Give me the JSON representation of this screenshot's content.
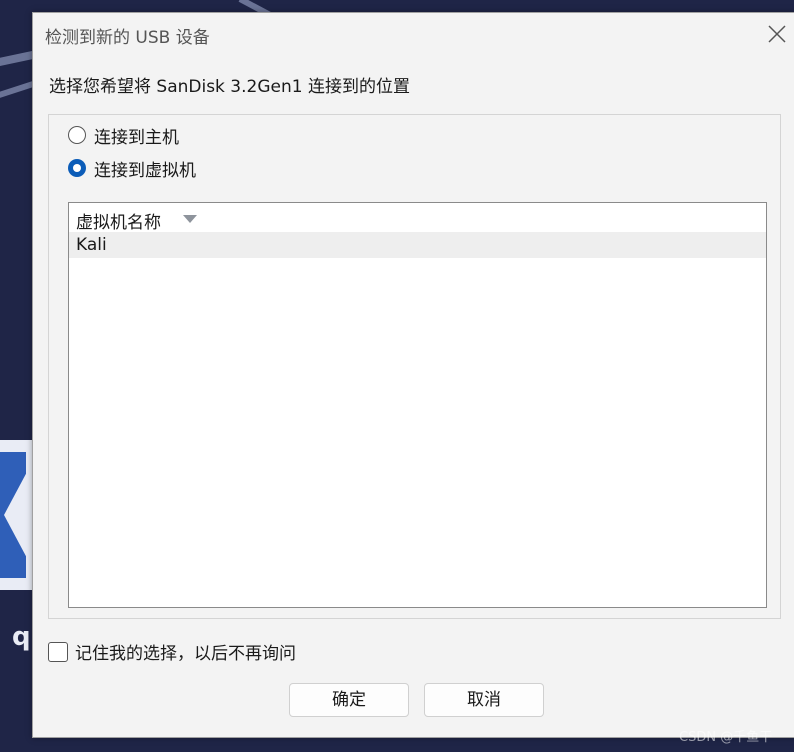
{
  "dialog": {
    "title": "检测到新的 USB 设备",
    "prompt": "选择您希望将 SanDisk 3.2Gen1 连接到的位置",
    "options": [
      {
        "label": "连接到主机",
        "checked": false
      },
      {
        "label": "连接到虚拟机",
        "checked": true
      }
    ],
    "vm_list": {
      "header": "虚拟机名称",
      "rows": [
        "Kali"
      ]
    },
    "remember_label": "记住我的选择，以后不再询问",
    "ok_label": "确定",
    "cancel_label": "取消"
  },
  "desktop": {
    "partial_text": "q"
  },
  "watermark": "CSDN @千鱼干",
  "colors": {
    "accent": "#0b5cb8",
    "dialog_bg": "#f3f3f3",
    "desktop_bg": "#1f2547"
  }
}
